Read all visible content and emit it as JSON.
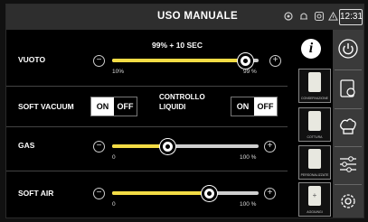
{
  "header": {
    "title": "USO MANUALE",
    "clock": "12:31"
  },
  "status_icons": [
    "gear-icon",
    "bell-icon",
    "camera-icon",
    "warning-icon",
    "wifi-icon"
  ],
  "vacuum": {
    "label": "VUOTO",
    "value_text": "99% + 10 SEC",
    "min_label": "10%",
    "max_label": "99 %",
    "level": 0.96
  },
  "soft_vacuum": {
    "label": "SOFT VACUUM",
    "on": "ON",
    "off": "OFF",
    "state": "on"
  },
  "liquid_control": {
    "label_line1": "CONTROLLO",
    "label_line2": "LIQUIDI",
    "on": "ON",
    "off": "OFF",
    "state": "off"
  },
  "gas": {
    "label": "GAS",
    "min_label": "0",
    "max_label": "100 %",
    "level": 0.36
  },
  "soft_air": {
    "label": "SOFT AIR",
    "min_label": "0",
    "max_label": "100 %",
    "level": 0.77
  },
  "programs": [
    {
      "label": "CONSERVAZIONE",
      "icon": "vacuum-bag-icon"
    },
    {
      "label": "COTTURA",
      "icon": "vacuum-bag-icon"
    },
    {
      "label": "PERSONALIZZATE",
      "icon": "vacuum-bag-icon"
    },
    {
      "label": "AGGIUNGI",
      "icon": "add-bag-icon"
    }
  ],
  "sidebar": [
    "power-icon",
    "bag-thermometer-icon",
    "chef-hat-icon",
    "sliders-icon",
    "settings-gear-icon"
  ],
  "colors": {
    "accent_yellow": "#f3dc45",
    "track_grey": "#cfcfcf",
    "header": "#2e2e2e",
    "sidebar": "#3a3a3a"
  }
}
